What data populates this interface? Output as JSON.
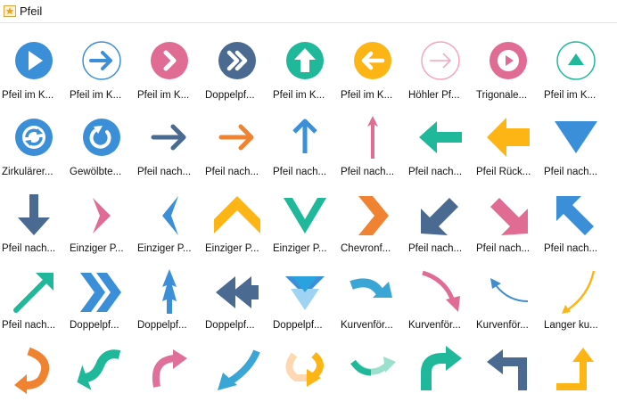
{
  "window": {
    "title": "Pfeil",
    "title_icon": "folder-star-icon"
  },
  "colors": {
    "blue": "#3b8fd9",
    "teal": "#1fb89a",
    "pink": "#e06b93",
    "navy": "#4a6a91",
    "orange": "#ef8332",
    "gold": "#fdb515",
    "rose": "#e0709a",
    "lightpink": "#f3a6b8"
  },
  "shapes": [
    {
      "label": "Pfeil im K...",
      "icon": "arrow-circle-play-icon"
    },
    {
      "label": "Pfeil im K...",
      "icon": "arrow-circle-outline-right-icon"
    },
    {
      "label": "Pfeil im K...",
      "icon": "arrow-circle-chevron-right-icon"
    },
    {
      "label": "Doppelpf...",
      "icon": "double-chevron-circle-icon"
    },
    {
      "label": "Pfeil im K...",
      "icon": "arrow-circle-up-icon"
    },
    {
      "label": "Pfeil im K...",
      "icon": "arrow-circle-left-icon"
    },
    {
      "label": "Höhler Pf...",
      "icon": "hollow-arrow-circle-icon"
    },
    {
      "label": "Trigonale...",
      "icon": "triangle-circle-right-icon"
    },
    {
      "label": "Pfeil im K...",
      "icon": "triangle-circle-up-icon"
    },
    {
      "label": "Zirkulärer...",
      "icon": "circular-arrows-icon"
    },
    {
      "label": "Gewölbte...",
      "icon": "curved-refresh-icon"
    },
    {
      "label": "Pfeil nach...",
      "icon": "arrow-right-navy-icon"
    },
    {
      "label": "Pfeil nach...",
      "icon": "arrow-right-orange-icon"
    },
    {
      "label": "Pfeil nach...",
      "icon": "arrow-up-blue-icon"
    },
    {
      "label": "Pfeil nach...",
      "icon": "arrow-up-thin-pink-icon"
    },
    {
      "label": "Pfeil nach...",
      "icon": "arrow-left-teal-icon"
    },
    {
      "label": "Pfeil Rück...",
      "icon": "arrow-back-gold-icon"
    },
    {
      "label": "Pfeil nach...",
      "icon": "triangle-down-icon"
    },
    {
      "label": "Pfeil nach...",
      "icon": "arrow-down-navy-icon"
    },
    {
      "label": "Einziger P...",
      "icon": "chevron-right-pink-icon"
    },
    {
      "label": "Einziger P...",
      "icon": "chevron-left-blue-icon"
    },
    {
      "label": "Einziger P...",
      "icon": "chevron-up-gold-icon"
    },
    {
      "label": "Einziger P...",
      "icon": "chevron-down-teal-icon"
    },
    {
      "label": "Chevronf...",
      "icon": "chevron-orange-icon"
    },
    {
      "label": "Pfeil nach...",
      "icon": "arrow-down-left-navy-icon"
    },
    {
      "label": "Pfeil nach...",
      "icon": "arrow-down-right-pink-icon"
    },
    {
      "label": "Pfeil nach...",
      "icon": "arrow-up-left-blue-icon"
    },
    {
      "label": "Pfeil nach...",
      "icon": "arrow-up-right-teal-icon"
    },
    {
      "label": "Doppelpf...",
      "icon": "double-chevron-right-icon"
    },
    {
      "label": "Doppelpf...",
      "icon": "double-arrow-up-icon"
    },
    {
      "label": "Doppelpf...",
      "icon": "double-arrow-left-icon"
    },
    {
      "label": "Doppelpf...",
      "icon": "double-triangle-down-icon"
    },
    {
      "label": "Kurvenför...",
      "icon": "curved-arrow-blue-icon"
    },
    {
      "label": "Kurvenför...",
      "icon": "curved-arrow-pink-icon"
    },
    {
      "label": "Kurvenför...",
      "icon": "curved-arrow-thin-blue-icon"
    },
    {
      "label": "Langer ku...",
      "icon": "long-curved-arrow-gold-icon"
    },
    {
      "label": "",
      "icon": "curved-arrow-orange-icon"
    },
    {
      "label": "",
      "icon": "curved-arrow-teal-icon"
    },
    {
      "label": "",
      "icon": "curved-arrow-rose-icon"
    },
    {
      "label": "",
      "icon": "curved-arrow-down-left-blue-icon"
    },
    {
      "label": "",
      "icon": "u-turn-arrow-icon"
    },
    {
      "label": "",
      "icon": "curved-arrow-teal-light-icon"
    },
    {
      "label": "",
      "icon": "bent-arrow-teal-icon"
    },
    {
      "label": "",
      "icon": "bent-arrow-navy-icon"
    },
    {
      "label": "",
      "icon": "bent-arrow-gold-icon"
    }
  ]
}
